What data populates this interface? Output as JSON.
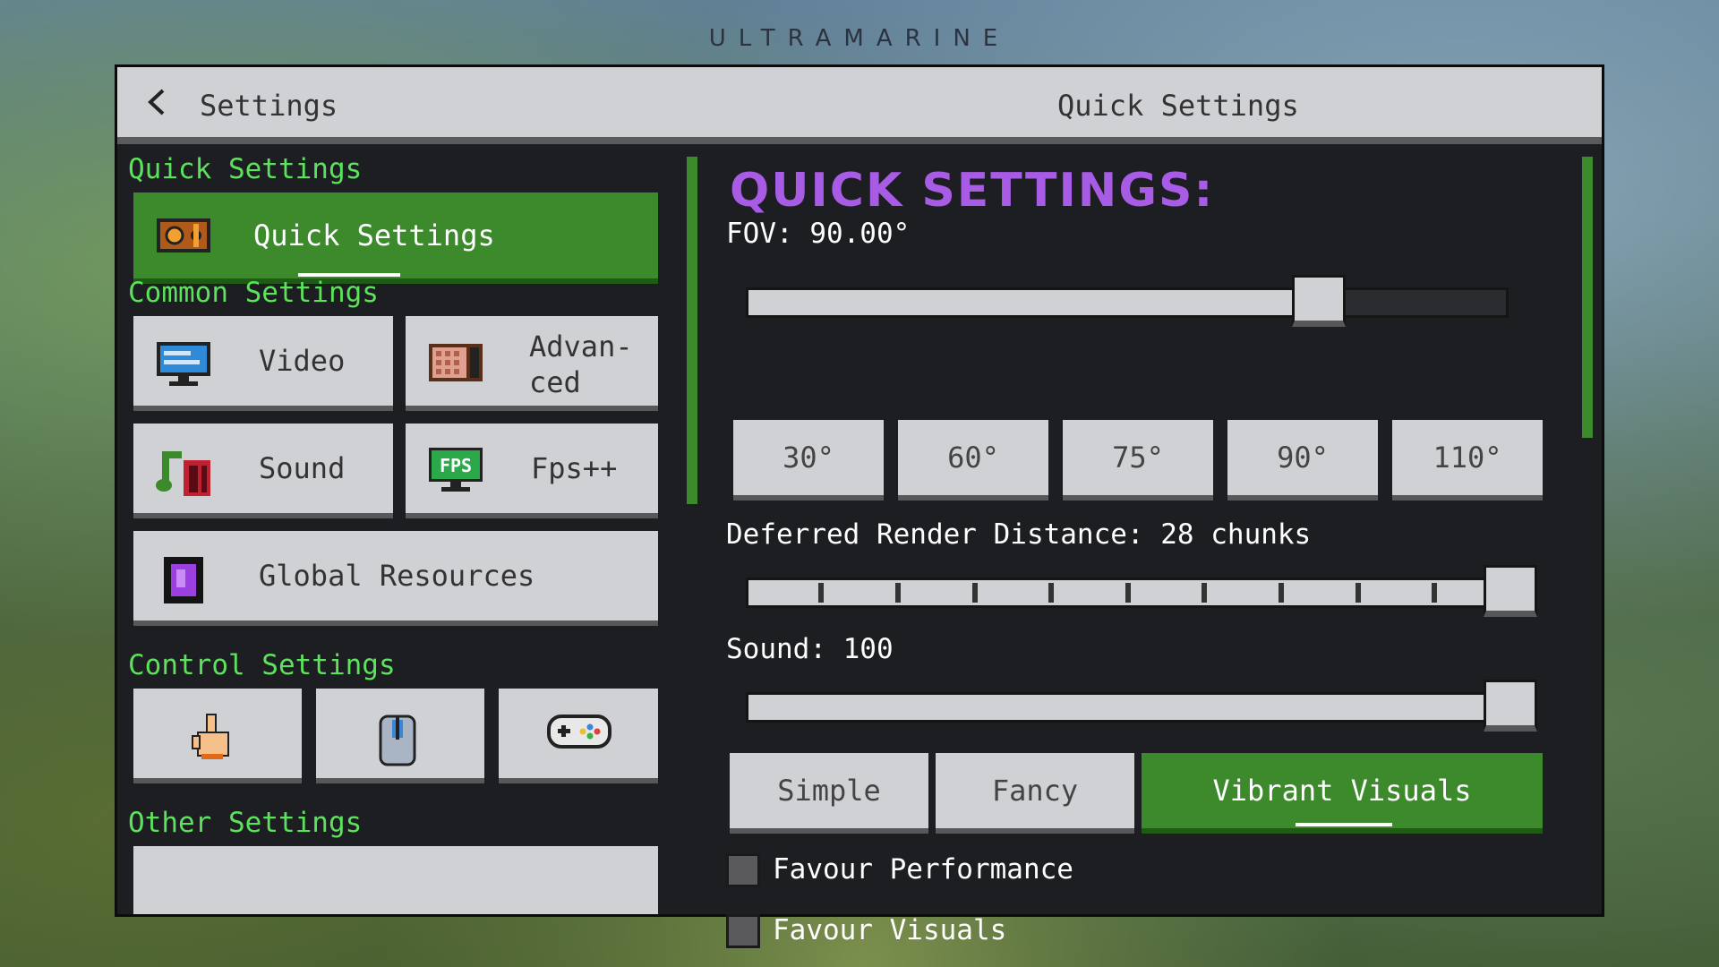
{
  "brand": "ULTRAMARINE",
  "topbar": {
    "back_label": "Settings",
    "title": "Quick Settings"
  },
  "sidebar": {
    "quick_section": "Quick Settings",
    "quick_item": "Quick Settings",
    "common_section": "Common Settings",
    "common_items": [
      "Video",
      "Advan-",
      "ced",
      "Sound",
      "Fps++",
      "Global Resources"
    ],
    "control_section": "Control Settings",
    "other_section": "Other Settings"
  },
  "main": {
    "heading": "QUICK SETTINGS:",
    "fov_label": "FOV: 90.00°",
    "fov_value": 90,
    "fov_slider_fraction": 0.74,
    "fov_presets": [
      "30°",
      "60°",
      "75°",
      "90°",
      "110°"
    ],
    "render_label": "Deferred Render Distance: 28 chunks",
    "render_slider_fraction": 1.0,
    "sound_label": "Sound: 100",
    "sound_slider_fraction": 1.0,
    "graphics_modes": [
      "Simple",
      "Fancy",
      "Vibrant Visuals"
    ],
    "graphics_selected": "Vibrant Visuals",
    "favour_performance": "Favour Performance",
    "favour_visuals": "Favour Visuals"
  },
  "colors": {
    "accent_green": "#3c8a2c",
    "section_green": "#5ce25c",
    "heading_purple": "#a85ce6"
  }
}
